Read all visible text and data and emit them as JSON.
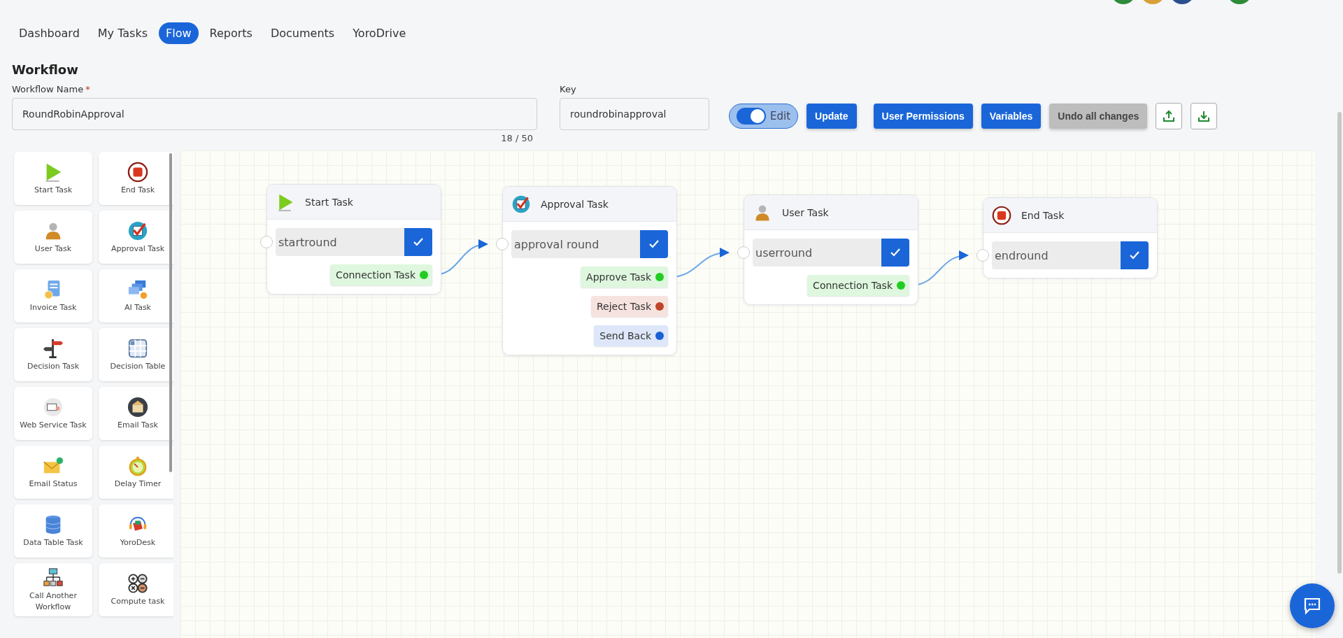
{
  "nav": [
    {
      "label": "Dashboard",
      "selected": false
    },
    {
      "label": "My Tasks",
      "selected": false
    },
    {
      "label": "Flow",
      "selected": true
    },
    {
      "label": "Reports",
      "selected": false
    },
    {
      "label": "Documents",
      "selected": false
    },
    {
      "label": "YoroDrive",
      "selected": false
    }
  ],
  "workflow": {
    "title": "Workflow",
    "name_label": "Workflow Name",
    "required_mark": "*",
    "name": "RoundRobinApproval",
    "counter": "18 / 50",
    "key_label": "Key",
    "key": "roundrobinapproval"
  },
  "edit_toggle": {
    "label": "Edit",
    "on": true
  },
  "buttons": [
    {
      "kind": "primary",
      "label": "Update"
    },
    {
      "kind": "primary",
      "label": "User Permissions"
    },
    {
      "kind": "primary",
      "label": "Variables"
    },
    {
      "kind": "muted",
      "label": "Undo all changes"
    },
    {
      "kind": "upload"
    },
    {
      "kind": "download"
    }
  ],
  "palette": [
    {
      "kind": "start",
      "label": "Start Task"
    },
    {
      "kind": "end",
      "label": "End Task"
    },
    {
      "kind": "user",
      "label": "User Task"
    },
    {
      "kind": "approval",
      "label": "Approval Task"
    },
    {
      "kind": "invoice",
      "label": "Invoice Task"
    },
    {
      "kind": "ai",
      "label": "AI Task"
    },
    {
      "kind": "decision",
      "label": "Decision Task"
    },
    {
      "kind": "decision_table",
      "label": "Decision Table"
    },
    {
      "kind": "web_service",
      "label": "Web Service Task"
    },
    {
      "kind": "email",
      "label": "Email Task"
    },
    {
      "kind": "email_status",
      "label": "Email Status"
    },
    {
      "kind": "timer",
      "label": "Delay Timer"
    },
    {
      "kind": "data_table",
      "label": "Data Table Task"
    },
    {
      "kind": "desk",
      "label": "YoroDesk"
    },
    {
      "kind": "subflow",
      "label": "Call Another Workflow"
    },
    {
      "kind": "compute",
      "label": "Compute task"
    }
  ],
  "nodes": [
    {
      "kind": "start",
      "title": "Start Task",
      "value": "startround",
      "outputs": [
        {
          "label": "Connection Task",
          "color": "#22cc22"
        }
      ]
    },
    {
      "kind": "approval",
      "title": "Approval Task",
      "value": "approval round",
      "outputs": [
        {
          "label": "Approve Task",
          "color": "#22cc22"
        },
        {
          "label": "Reject Task",
          "color": "#c0442a"
        },
        {
          "label": "Send Back",
          "color": "#1a5fd6"
        }
      ]
    },
    {
      "kind": "user",
      "title": "User Task",
      "value": "userround",
      "outputs": [
        {
          "label": "Connection Task",
          "color": "#22cc22"
        }
      ]
    },
    {
      "kind": "end",
      "title": "End Task",
      "value": "endround"
    }
  ]
}
